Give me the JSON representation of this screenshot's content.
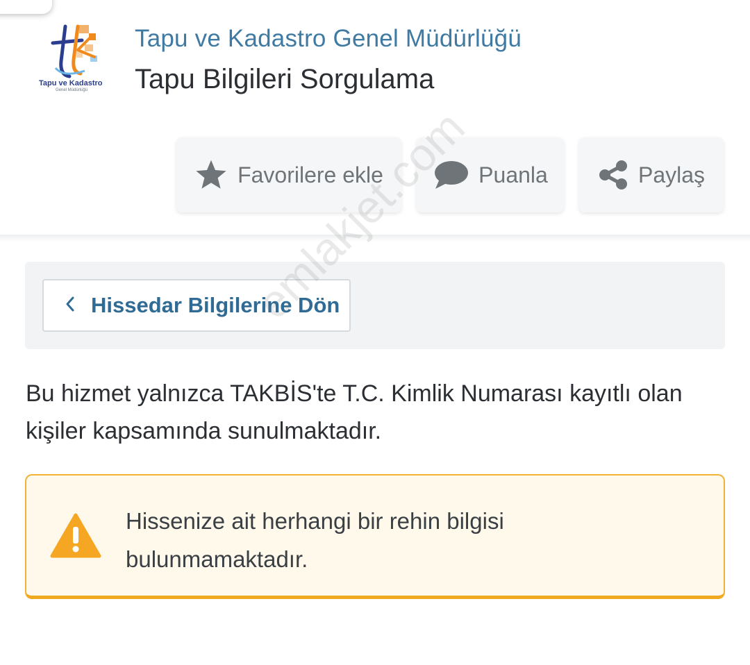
{
  "header": {
    "org_name": "Tapu ve Kadastro Genel Müdürlüğü",
    "service_title": "Tapu Bilgileri Sorgulama",
    "logo": {
      "line1": "Tapu ve Kadastro",
      "line2": "Genel Müdürlüğü",
      "colors": [
        "#2b3d8f",
        "#f08a1c",
        "#6bb6e6"
      ]
    }
  },
  "actions": {
    "favorite": {
      "label": "Favorilere ekle",
      "icon": "star-icon"
    },
    "rate": {
      "label": "Puanla",
      "icon": "speech-bubble-icon"
    },
    "share": {
      "label": "Paylaş",
      "icon": "share-icon"
    }
  },
  "back": {
    "label": "Hissedar Bilgilerine Dön",
    "icon": "chevron-left-icon"
  },
  "info": {
    "line1": "Bu hizmet yalnızca TAKBİS'te T.C. Kimlik Numarası kayıtlı olan",
    "line2": "kişiler kapsamında sunulmaktadır."
  },
  "alert": {
    "line1": "Hissenize ait herhangi bir rehin bilgisi",
    "line2": "bulunmamaktadır.",
    "icon": "warning-icon",
    "accent": "#f0a91f"
  },
  "watermark": "emlakjet.com",
  "colors": {
    "link": "#2f6b95",
    "org": "#3f7aa3",
    "icon": "#6f7478"
  }
}
